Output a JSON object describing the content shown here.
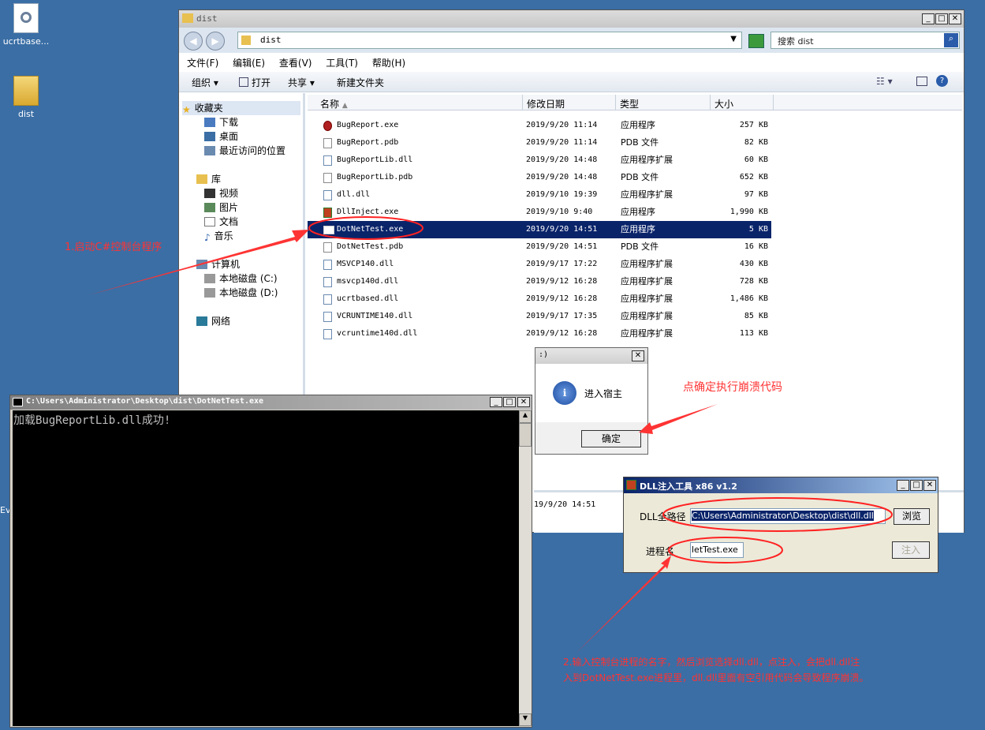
{
  "desktop": {
    "icons": [
      {
        "label": "ucrtbase..."
      },
      {
        "label": "dist"
      }
    ],
    "partial_label": "Ev"
  },
  "explorer": {
    "title": "dist",
    "address": "dist",
    "search_placeholder": "搜索 dist",
    "menu": [
      "文件(F)",
      "编辑(E)",
      "查看(V)",
      "工具(T)",
      "帮助(H)"
    ],
    "toolbar": {
      "organize": "组织",
      "share": "共享",
      "new_folder": "新建文件夹"
    },
    "nav": {
      "favorites": "收藏夹",
      "favorites_items": [
        "下载",
        "桌面",
        "最近访问的位置"
      ],
      "libraries": "库",
      "library_items": [
        "视频",
        "图片",
        "文档",
        "音乐"
      ],
      "computer": "计算机",
      "drives": [
        "本地磁盘 (C:)",
        "本地磁盘 (D:)"
      ],
      "network": "网络"
    },
    "columns": {
      "name": "名称",
      "date": "修改日期",
      "type": "类型",
      "size": "大小"
    },
    "files": [
      {
        "name": "BugReport.exe",
        "date": "2019/9/20 11:14",
        "type": "应用程序",
        "size": "257 KB"
      },
      {
        "name": "BugReport.pdb",
        "date": "2019/9/20 11:14",
        "type": "PDB 文件",
        "size": "82 KB"
      },
      {
        "name": "BugReportLib.dll",
        "date": "2019/9/20 14:48",
        "type": "应用程序扩展",
        "size": "60 KB"
      },
      {
        "name": "BugReportLib.pdb",
        "date": "2019/9/20 14:48",
        "type": "PDB 文件",
        "size": "652 KB"
      },
      {
        "name": "dll.dll",
        "date": "2019/9/10 19:39",
        "type": "应用程序扩展",
        "size": "97 KB"
      },
      {
        "name": "DllInject.exe",
        "date": "2019/9/10 9:40",
        "type": "应用程序",
        "size": "1,990 KB"
      },
      {
        "name": "DotNetTest.exe",
        "date": "2019/9/20 14:51",
        "type": "应用程序",
        "size": "5 KB"
      },
      {
        "name": "DotNetTest.pdb",
        "date": "2019/9/20 14:51",
        "type": "PDB 文件",
        "size": "16 KB"
      },
      {
        "name": "MSVCP140.dll",
        "date": "2019/9/17 17:22",
        "type": "应用程序扩展",
        "size": "430 KB"
      },
      {
        "name": "msvcp140d.dll",
        "date": "2019/9/12 16:28",
        "type": "应用程序扩展",
        "size": "728 KB"
      },
      {
        "name": "ucrtbased.dll",
        "date": "2019/9/12 16:28",
        "type": "应用程序扩展",
        "size": "1,486 KB"
      },
      {
        "name": "VCRUNTIME140.dll",
        "date": "2019/9/17 17:35",
        "type": "应用程序扩展",
        "size": "85 KB"
      },
      {
        "name": "vcruntime140d.dll",
        "date": "2019/9/12 16:28",
        "type": "应用程序扩展",
        "size": "113 KB"
      }
    ],
    "details_date": "19/9/20 14:51"
  },
  "console": {
    "title": "C:\\Users\\Administrator\\Desktop\\dist\\DotNetTest.exe",
    "output": "加载BugReportLib.dll成功!"
  },
  "msgbox": {
    "title": ":)",
    "message": "进入宿主",
    "ok": "确定"
  },
  "injector": {
    "title": "DLL注入工具 x86 v1.2",
    "dll_label": "DLL全路径",
    "dll_path": "C:\\Users\\Administrator\\Desktop\\dist\\dll.dll",
    "browse": "浏览",
    "proc_label": "进程名",
    "proc_value": "letTest.exe",
    "inject": "注入"
  },
  "annotations": {
    "step1": "1.启动C#控制台程序",
    "step_ok": "点确定执行崩溃代码",
    "step2_line1": "2.输入控制台进程的名字，然后浏览选择dll.dll，点注入，会把dll.dll注",
    "step2_line2": "入到DotNetTest.exe进程里，dll.dll里面有空引用代码会导致程序崩溃。"
  }
}
